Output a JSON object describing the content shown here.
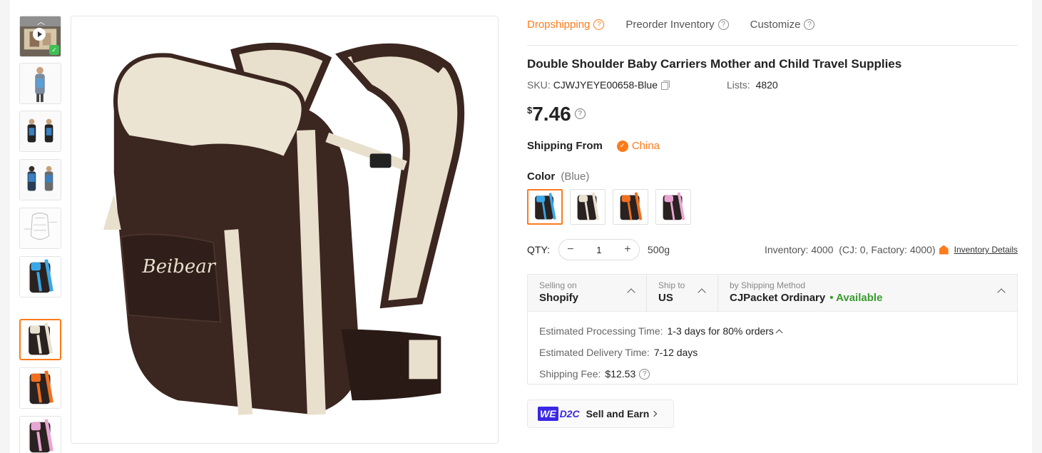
{
  "tabs": [
    {
      "label": "Dropshipping",
      "active": true
    },
    {
      "label": "Preorder Inventory",
      "active": false
    },
    {
      "label": "Customize",
      "active": false
    }
  ],
  "product": {
    "title": "Double Shoulder Baby Carriers Mother and Child Travel Supplies",
    "sku_label": "SKU:",
    "sku_value": "CJWJYEYE00658-Blue",
    "lists_label": "Lists:",
    "lists_value": "4820",
    "currency_symbol": "$",
    "price": "7.46",
    "ship_from_label": "Shipping From",
    "ship_from_value": "China",
    "color_label": "Color",
    "color_value": "(Blue)",
    "swatches": [
      {
        "name": "Blue",
        "accent": "#3aa8e8"
      },
      {
        "name": "Beige",
        "accent": "#e9e1cf"
      },
      {
        "name": "Orange",
        "accent": "#f07020"
      },
      {
        "name": "Pink",
        "accent": "#e8a6d4"
      }
    ],
    "selected_swatch": 0
  },
  "quantity": {
    "label": "QTY:",
    "minus": "−",
    "plus": "+",
    "value": "1",
    "weight": "500g",
    "inventory_text": "Inventory: 4000  (CJ: 0, Factory: 4000)",
    "inventory_link": "Inventory Details"
  },
  "shipping": {
    "selling_on_label": "Selling on",
    "selling_on_value": "Shopify",
    "ship_to_label": "Ship to",
    "ship_to_value": "US",
    "method_label": "by Shipping Method",
    "method_value": "CJPacket Ordinary",
    "method_status": "• Available",
    "processing_label": "Estimated Processing Time:",
    "processing_value": "1-3 days for 80% orders",
    "delivery_label": "Estimated Delivery Time:",
    "delivery_value": "7-12 days",
    "fee_label": "Shipping Fee:",
    "fee_value": "$12.53"
  },
  "promo": {
    "we": "WE",
    "d2c": "D2C",
    "label": "Sell and Earn"
  },
  "colors": {
    "accent": "#ff7a1a",
    "available": "#3a9b2f",
    "brand_we": "#3a27e6"
  },
  "thumbnails": [
    {
      "kind": "video",
      "accent": "#d6c6a8"
    },
    {
      "kind": "model-front",
      "accent": "#5aa0d8"
    },
    {
      "kind": "two-models",
      "accent": "#3a7fc0"
    },
    {
      "kind": "two-models-back",
      "accent": "#3a7fc0"
    },
    {
      "kind": "diagram",
      "accent": "#cccccc"
    },
    {
      "kind": "carrier",
      "accent": "#3aa8e8"
    },
    {
      "kind": "carrier",
      "accent": "#e9e1cf"
    },
    {
      "kind": "carrier",
      "accent": "#f07020"
    },
    {
      "kind": "carrier",
      "accent": "#e8a6d4"
    }
  ],
  "active_thumbnail": 6
}
